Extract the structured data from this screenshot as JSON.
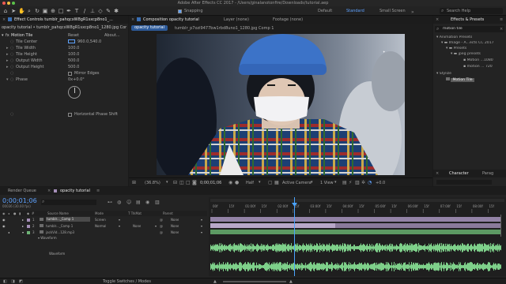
{
  "titlebar": {
    "title": "Adobe After Effects CC 2017 - /Users/ginalanotonfire/Downloads/tutorial.aep"
  },
  "toolbar": {
    "snapping_label": "Snapping",
    "workspaces": [
      "Default",
      "Standard",
      "Small Screen"
    ],
    "active_workspace": "Standard",
    "search_help": "Search Help"
  },
  "effect_controls": {
    "tab": "Effect Controls tumblr_pahqcxW8gR1sxcp8no1_...",
    "header": "opacity tutorial • tumblr_pahqcxW8gR1sxcp8no1_1280.jpg Comp",
    "effect_name": "Motion Tile",
    "reset": "Reset",
    "about": "About...",
    "props": [
      {
        "name": "Tile Center",
        "value": "960.0,540.0"
      },
      {
        "name": "Tile Width",
        "value": "100.0"
      },
      {
        "name": "Tile Height",
        "value": "100.0"
      },
      {
        "name": "Output Width",
        "value": "500.0"
      },
      {
        "name": "Output Height",
        "value": "500.0"
      }
    ],
    "mirror_edges": "Mirror Edges",
    "phase_label": "Phase",
    "phase_value": "0x+0.0°",
    "horizontal_phase_shift": "Horizontal Phase Shift"
  },
  "viewer": {
    "comp_tab": "Composition opacity tutorial",
    "layer_tab": "Layer (none)",
    "footage_tab": "Footage (none)",
    "breadcrumb": "opacity tutorial",
    "breadcrumb2": "tumblr_p7ozi9477bw1rbd8uno1_1280.jpg Comp 1",
    "zoom": "(36.8%)",
    "timecode": "0;00;01;06",
    "resolution": "Half",
    "camera": "Active Camera",
    "views": "1 View",
    "exposure": "+0.0"
  },
  "effects_presets": {
    "tab": "Effects & Presets",
    "search_value": "motion tile",
    "tree": [
      "Animation Presets",
      "Image - A...ects CC 2017",
      "Presets",
      "jpeg presets",
      "Motion ...1080",
      "motion ... 720",
      "Stylize",
      "Motion Tile"
    ],
    "character_tab": "Character",
    "paragraph_tab": "Parag"
  },
  "timeline": {
    "render_queue_tab": "Render Queue",
    "comp_tab": "opacity tutorial",
    "timecode": "0;00;01;06",
    "fps": "00036 (30.00 fps)",
    "columns": [
      "Source Name",
      "Mode",
      "T TrkMat",
      "Parent"
    ],
    "layers": [
      {
        "num": "1",
        "name": "tumblr..._Comp 1",
        "mode": "Screen",
        "trkmat": "",
        "parent": "None"
      },
      {
        "num": "2",
        "name": "tumblr..._Comp 1",
        "mode": "Normal",
        "trkmat": "None",
        "parent": "None"
      },
      {
        "num": "3",
        "name": "jackVid...128.mp3",
        "mode": "",
        "trkmat": "",
        "parent": "None"
      }
    ],
    "waveform_label": "Waveform",
    "waveform_sublabel": "Waveform",
    "ruler_ticks": [
      "00f",
      "15f",
      "01:00f",
      "15f",
      "02:00f",
      "15f",
      "03:00f",
      "15f",
      "04:00f",
      "15f",
      "05:00f",
      "15f",
      "06:00f",
      "15f",
      "07:00f",
      "15f",
      "08:00f",
      "15f"
    ],
    "toggle_label": "Toggle Switches / Modes"
  },
  "colors": {
    "accent_blue": "#5ea2ff",
    "layer_purple": "#a58fb8",
    "layer_green": "#6eb376",
    "audio_green": "#7ed08a",
    "playhead": "#4aa3ff"
  }
}
